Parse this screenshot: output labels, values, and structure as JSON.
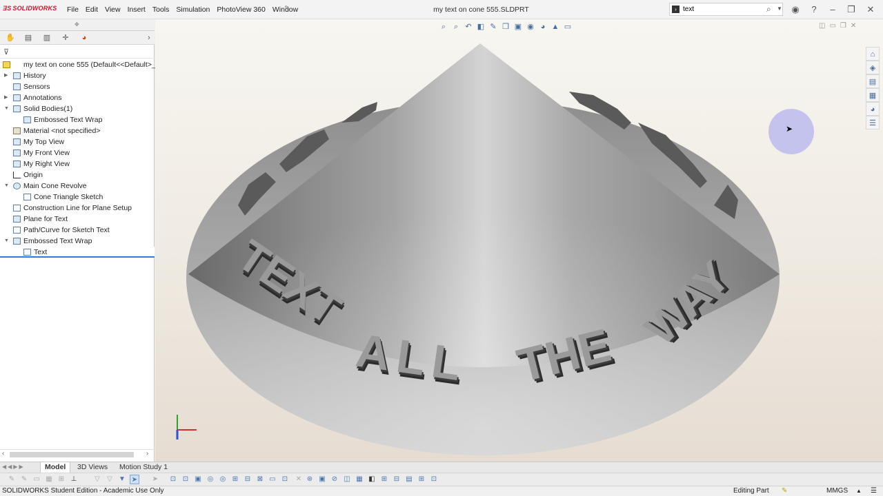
{
  "app": {
    "brand": "SOLIDWORKS",
    "document_title": "my text on cone 555.SLDPRT"
  },
  "menu": {
    "items": [
      "File",
      "Edit",
      "View",
      "Insert",
      "Tools",
      "Simulation",
      "PhotoView 360",
      "Window"
    ]
  },
  "search": {
    "value": "text"
  },
  "feature_tree": {
    "root": "my text on cone 555  (Default<<Default>_",
    "items": [
      {
        "label": "History"
      },
      {
        "label": "Sensors"
      },
      {
        "label": "Annotations"
      },
      {
        "label": "Solid Bodies(1)"
      },
      {
        "label": "Embossed Text Wrap"
      },
      {
        "label": "Material <not specified>"
      },
      {
        "label": "My Top View"
      },
      {
        "label": "My Front View"
      },
      {
        "label": "My Right View"
      },
      {
        "label": "Origin"
      },
      {
        "label": "Main Cone Revolve"
      },
      {
        "label": "Cone Triangle Sketch"
      },
      {
        "label": "Construction Line for Plane Setup"
      },
      {
        "label": "Plane for Text"
      },
      {
        "label": "Path/Curve for Sketch Text"
      },
      {
        "label": "Embossed Text Wrap"
      },
      {
        "label": "Text"
      }
    ]
  },
  "model": {
    "words": [
      "TEXT",
      "ALL",
      "THE",
      "WAY"
    ],
    "back_words": [
      "TEXT",
      "ALL",
      "THE",
      "WAY"
    ]
  },
  "bottom_tabs": [
    "Model",
    "3D Views",
    "Motion Study 1"
  ],
  "status": {
    "left": "SOLIDWORKS Student Edition - Academic Use Only",
    "mode": "Editing Part",
    "units": "MMGS"
  },
  "colors": {
    "brand_red": "#d0142b",
    "selection_blue": "#2a7fd4"
  }
}
